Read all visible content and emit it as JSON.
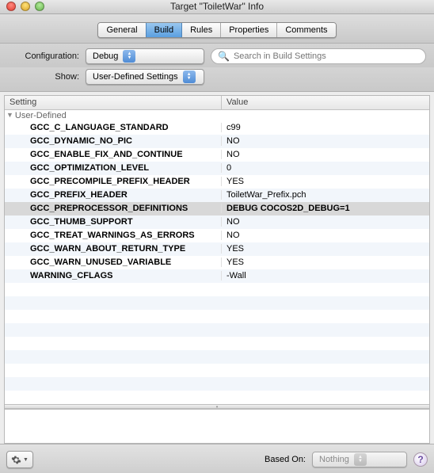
{
  "window": {
    "title": "Target \"ToiletWar\" Info"
  },
  "tabs": [
    {
      "label": "General"
    },
    {
      "label": "Build",
      "active": true
    },
    {
      "label": "Rules"
    },
    {
      "label": "Properties"
    },
    {
      "label": "Comments"
    }
  ],
  "configuration": {
    "label": "Configuration:",
    "value": "Debug"
  },
  "search": {
    "placeholder": "Search in Build Settings"
  },
  "show": {
    "label": "Show:",
    "value": "User-Defined Settings"
  },
  "columns": {
    "setting": "Setting",
    "value": "Value"
  },
  "group": "User-Defined",
  "rows": [
    {
      "k": "GCC_C_LANGUAGE_STANDARD",
      "v": "c99"
    },
    {
      "k": "GCC_DYNAMIC_NO_PIC",
      "v": "NO"
    },
    {
      "k": "GCC_ENABLE_FIX_AND_CONTINUE",
      "v": "NO"
    },
    {
      "k": "GCC_OPTIMIZATION_LEVEL",
      "v": "0"
    },
    {
      "k": "GCC_PRECOMPILE_PREFIX_HEADER",
      "v": "YES"
    },
    {
      "k": "GCC_PREFIX_HEADER",
      "v": "ToiletWar_Prefix.pch"
    },
    {
      "k": "GCC_PREPROCESSOR_DEFINITIONS",
      "v": "DEBUG COCOS2D_DEBUG=1",
      "selected": true
    },
    {
      "k": "GCC_THUMB_SUPPORT",
      "v": "NO"
    },
    {
      "k": "GCC_TREAT_WARNINGS_AS_ERRORS",
      "v": "NO"
    },
    {
      "k": "GCC_WARN_ABOUT_RETURN_TYPE",
      "v": "YES"
    },
    {
      "k": "GCC_WARN_UNUSED_VARIABLE",
      "v": "YES"
    },
    {
      "k": "WARNING_CFLAGS",
      "v": "-Wall"
    }
  ],
  "footer": {
    "basedOnLabel": "Based On:",
    "basedOnValue": "Nothing"
  }
}
